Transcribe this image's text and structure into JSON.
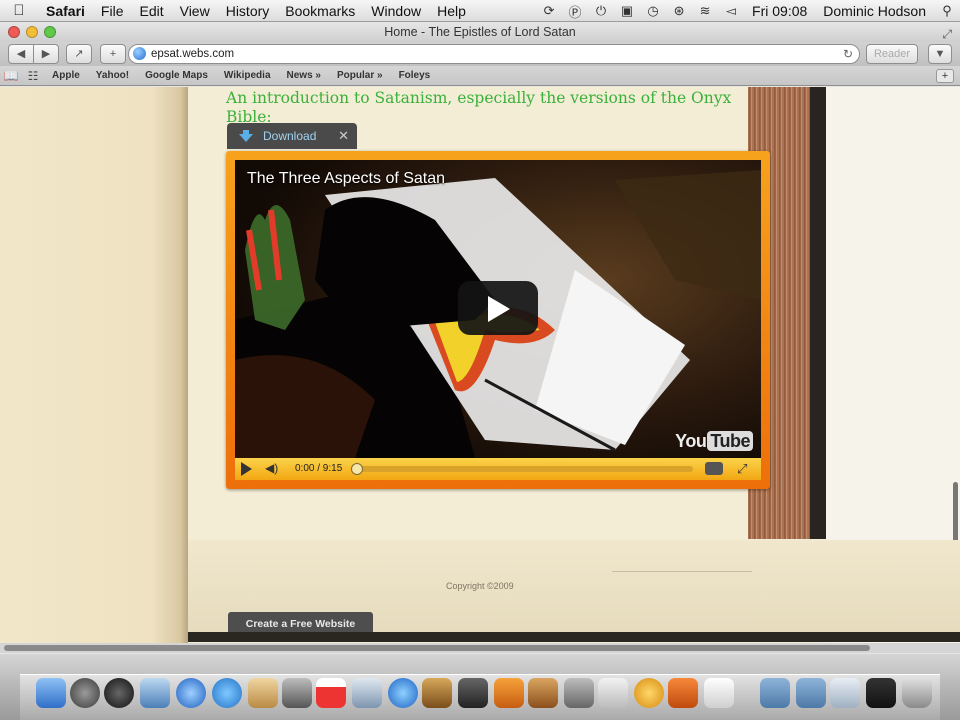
{
  "menubar": {
    "app": "Safari",
    "items": [
      "File",
      "Edit",
      "View",
      "History",
      "Bookmarks",
      "Window",
      "Help"
    ],
    "clock": "Fri 09:08",
    "user": "Dominic Hodson"
  },
  "window": {
    "title": "Home - The Epistles of Lord Satan",
    "url": "epsat.webs.com",
    "reader_label": "Reader"
  },
  "bookmarks": [
    "Apple",
    "Yahoo!",
    "Google Maps",
    "Wikipedia",
    "News »",
    "Popular »",
    "Foleys"
  ],
  "content": {
    "intro": "An introduction to Satanism, especially the versions of the Onyx Bible:",
    "download_label": "Download",
    "video": {
      "title": "The Three Aspects of Satan",
      "time": "0:00 / 9:15",
      "logo_you": "You",
      "logo_tube": "Tube"
    },
    "copyright": "Copyright ©2009",
    "create_site_label": "Create a Free Website"
  },
  "colors": {
    "intro_text": "#3ab13a",
    "video_frame": "#f28a12",
    "download_text": "#9fd2f2"
  }
}
